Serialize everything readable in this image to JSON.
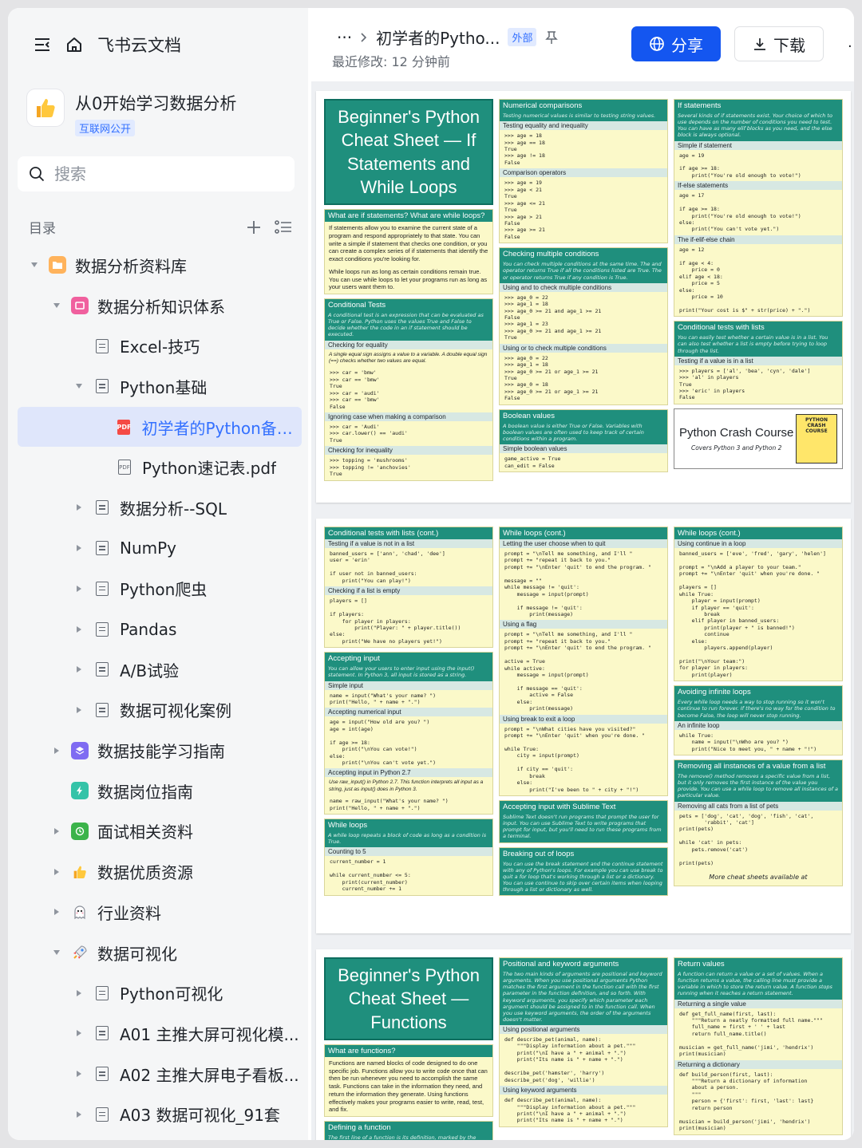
{
  "sidebar": {
    "brand": "飞书云文档",
    "space_title": "从0开始学习数据分析",
    "space_badge": "互联网公开",
    "search_placeholder": "搜索",
    "toc_label": "目录",
    "tree": [
      {
        "label": "数据分析资料库",
        "level": 0,
        "arrow": "down",
        "icon": "folder-orange"
      },
      {
        "label": "数据分析知识体系",
        "level": 1,
        "arrow": "down",
        "icon": "board-pink"
      },
      {
        "label": "Excel-技巧",
        "level": 2,
        "arrow": "",
        "icon": "doc"
      },
      {
        "label": "Python基础",
        "level": 2,
        "arrow": "down",
        "icon": "doc"
      },
      {
        "label": "初学者的Python备忘...",
        "level": 3,
        "arrow": "",
        "icon": "pdf-red",
        "active": true
      },
      {
        "label": "Python速记表.pdf",
        "level": 3,
        "arrow": "",
        "icon": "pdf"
      },
      {
        "label": "数据分析--SQL",
        "level": 2,
        "arrow": "right",
        "icon": "doc"
      },
      {
        "label": "NumPy",
        "level": 2,
        "arrow": "right",
        "icon": "doc"
      },
      {
        "label": "Python爬虫",
        "level": 2,
        "arrow": "right",
        "icon": "doc"
      },
      {
        "label": "Pandas",
        "level": 2,
        "arrow": "right",
        "icon": "doc"
      },
      {
        "label": "A/B试验",
        "level": 2,
        "arrow": "right",
        "icon": "doc"
      },
      {
        "label": "数据可视化案例",
        "level": 2,
        "arrow": "right",
        "icon": "doc"
      },
      {
        "label": "数据技能学习指南",
        "level": 1,
        "arrow": "right",
        "icon": "stack-purple"
      },
      {
        "label": "数据岗位指南",
        "level": 1,
        "arrow": "",
        "icon": "bolt-green"
      },
      {
        "label": "面试相关资料",
        "level": 1,
        "arrow": "right",
        "icon": "clock-green"
      },
      {
        "label": "数据优质资源",
        "level": 1,
        "arrow": "right",
        "icon": "thumb"
      },
      {
        "label": "行业资料",
        "level": 1,
        "arrow": "right",
        "icon": "ghost"
      },
      {
        "label": "数据可视化",
        "level": 1,
        "arrow": "down",
        "icon": "rocket"
      },
      {
        "label": "Python可视化",
        "level": 2,
        "arrow": "right",
        "icon": "doc"
      },
      {
        "label": "A01 主推大屏可视化模...",
        "level": 2,
        "arrow": "right",
        "icon": "doc"
      },
      {
        "label": "A02 主推大屏电子看板...",
        "level": 2,
        "arrow": "right",
        "icon": "doc"
      },
      {
        "label": "A03 数据可视化_91套",
        "level": 2,
        "arrow": "right",
        "icon": "doc"
      }
    ]
  },
  "header": {
    "ellipsis": "···",
    "doc_title": "初学者的Pytho...",
    "badge": "外部",
    "modified": "最近修改: 12 分钟前",
    "share": "分享",
    "download": "下载"
  },
  "sheet1": {
    "title": "Beginner's Python Cheat Sheet — If Statements and While Loops",
    "what_h": "What are if statements? What are while loops?",
    "what_p1": "If statements allow you to examine the current state of a program and respond appropriately to that state. You can write a simple if statement that checks one condition, or you can create a complex series of if statements that identify the exact conditions you're looking for.",
    "what_p2": "While loops run as long as certain conditions remain true. You can use while loops to let your programs run as long as your users want them to.",
    "cond_h": "Conditional Tests",
    "cond_d": "A conditional test is an expression that can be evaluated as True or False. Python uses the values True and False to decide whether the code in an if statement should be executed.",
    "eq_s": "Checking for equality",
    "eq_d": "A single equal sign assigns a value to a variable. A double equal sign (==) checks whether two values are equal.",
    "eq_c": ">>> car = 'bmw'\n>>> car == 'bmw'\nTrue\n>>> car = 'audi'\n>>> car == 'bmw'\nFalse",
    "ign_s": "Ignoring case when making a comparison",
    "ign_c": ">>> car = 'Audi'\n>>> car.lower() == 'audi'\nTrue",
    "neq_s": "Checking for inequality",
    "neq_c": ">>> topping = 'mushrooms'\n>>> topping != 'anchovies'\nTrue",
    "num_h": "Numerical comparisons",
    "num_d": "Testing numerical values is similar to testing string values.",
    "num_s1": "Testing equality and inequality",
    "num_c1": ">>> age = 18\n>>> age == 18\nTrue\n>>> age != 18\nFalse",
    "num_s2": "Comparison operators",
    "num_c2": ">>> age = 19\n>>> age < 21\nTrue\n>>> age <= 21\nTrue\n>>> age > 21\nFalse\n>>> age >= 21\nFalse",
    "mult_h": "Checking multiple conditions",
    "mult_d": "You can check multiple conditions at the same time. The and operator returns True if all the conditions listed are True. The or operator returns True if any condition is True.",
    "and_s": "Using and to check multiple conditions",
    "and_c": ">>> age_0 = 22\n>>> age_1 = 18\n>>> age_0 >= 21 and age_1 >= 21\nFalse\n>>> age_1 = 23\n>>> age_0 >= 21 and age_1 >= 21\nTrue",
    "or_s": "Using or to check multiple conditions",
    "or_c": ">>> age_0 = 22\n>>> age_1 = 18\n>>> age_0 >= 21 or age_1 >= 21\nTrue\n>>> age_0 = 18\n>>> age_0 >= 21 or age_1 >= 21\nFalse",
    "bool_h": "Boolean values",
    "bool_d": "A boolean value is either True or False. Variables with boolean values are often used to keep track of certain conditions within a program.",
    "bool_s": "Simple boolean values",
    "bool_c": "game_active = True\ncan_edit = False",
    "if_h": "If statements",
    "if_d": "Several kinds of if statements exist. Your choice of which to use depends on the number of conditions you need to test. You can have as many elif blocks as you need, and the else block is always optional.",
    "if_s1": "Simple if statement",
    "if_c1": "age = 19\n\nif age >= 18:\n    print(\"You're old enough to vote!\")",
    "if_s2": "If-else statements",
    "if_c2": "age = 17\n\nif age >= 18:\n    print(\"You're old enough to vote!\")\nelse:\n    print(\"You can't vote yet.\")",
    "if_s3": "The if-elif-else chain",
    "if_c3": "age = 12\n\nif age < 4:\n    price = 0\nelif age < 18:\n    price = 5\nelse:\n    price = 10\n\nprint(\"Your cost is $\" + str(price) + \".\")",
    "lst_h": "Conditional tests with lists",
    "lst_d": "You can easily test whether a certain value is in a list. You can also test whether a list is empty before trying to loop through the list.",
    "lst_s": "Testing if a value is in a list",
    "lst_c": ">>> players = ['al', 'bea', 'cyn', 'dale']\n>>> 'al' in players\nTrue\n>>> 'eric' in players\nFalse",
    "book_title": "Python Crash Course",
    "book_sub": "Covers Python 3 and Python 2",
    "book_cover": "PYTHON CRASH COURSE"
  },
  "sheet2": {
    "c1_h": "Conditional tests with lists (cont.)",
    "c1_s1": "Testing if a value is not in a list",
    "c1_c1": "banned_users = ['ann', 'chad', 'dee']\nuser = 'erin'\n\nif user not in banned_users:\n    print(\"You can play!\")",
    "c1_s2": "Checking if a list is empty",
    "c1_c2": "players = []\n\nif players:\n    for player in players:\n        print(\"Player: \" + player.title())\nelse:\n    print(\"We have no players yet!\")",
    "in_h": "Accepting input",
    "in_d": "You can allow your users to enter input using the input() statement. In Python 3, all input is stored as a string.",
    "in_s1": "Simple input",
    "in_c1": "name = input(\"What's your name? \")\nprint(\"Hello, \" + name + \".\")",
    "in_s2": "Accepting numerical input",
    "in_c2": "age = input(\"How old are you? \")\nage = int(age)\n\nif age >= 18:\n    print(\"\\nYou can vote!\")\nelse:\n    print(\"\\nYou can't vote yet.\")",
    "in_s3": "Accepting input in Python 2.7",
    "in_d3": "Use raw_input() in Python 2.7. This function interprets all input as a string, just as input() does in Python 3.",
    "in_c3": "name = raw_input(\"What's your name? \")\nprint(\"Hello, \" + name + \".\")",
    "wl_h": "While loops",
    "wl_d": "A while loop repeats a block of code as long as a condition is True.",
    "wl_s": "Counting to 5",
    "wl_c": "current_number = 1\n\nwhile current_number <= 5:\n    print(current_number)\n    current_number += 1",
    "w2_h": "While loops (cont.)",
    "w2_s1": "Letting the user choose when to quit",
    "w2_c1": "prompt = \"\\nTell me something, and I'll \"\nprompt += \"repeat it back to you.\"\nprompt += \"\\nEnter 'quit' to end the program. \"\n\nmessage = \"\"\nwhile message != 'quit':\n    message = input(prompt)\n\n    if message != 'quit':\n        print(message)",
    "w2_s2": "Using a flag",
    "w2_c2": "prompt = \"\\nTell me something, and I'll \"\nprompt += \"repeat it back to you.\"\nprompt += \"\\nEnter 'quit' to end the program. \"\n\nactive = True\nwhile active:\n    message = input(prompt)\n\n    if message == 'quit':\n        active = False\n    else:\n        print(message)",
    "w2_s3": "Using break to exit a loop",
    "w2_c3": "prompt = \"\\nWhat cities have you visited?\"\nprompt += \"\\nEnter 'quit' when you're done. \"\n\nwhile True:\n    city = input(prompt)\n\n    if city == 'quit':\n        break\n    else:\n        print(\"I've been to \" + city + \"!\")",
    "sub_h": "Accepting input with Sublime Text",
    "sub_d": "Sublime Text doesn't run programs that prompt the user for input. You can use Sublime Text to write programs that prompt for input, but you'll need to run these programs from a terminal.",
    "brk_h": "Breaking out of loops",
    "brk_d": "You can use the break statement and the continue statement with any of Python's loops. For example you can use break to quit a for loop that's working through a list or a dictionary. You can use continue to skip over certain items when looping through a list or dictionary as well.",
    "w3_h": "While loops (cont.)",
    "w3_s1": "Using continue in a loop",
    "w3_c1": "banned_users = ['eve', 'fred', 'gary', 'helen']\n\nprompt = \"\\nAdd a player to your team.\"\nprompt += \"\\nEnter 'quit' when you're done. \"\n\nplayers = []\nwhile True:\n    player = input(prompt)\n    if player == 'quit':\n        break\n    elif player in banned_users:\n        print(player + \" is banned!\")\n        continue\n    else:\n        players.append(player)\n\nprint(\"\\nYour team:\")\nfor player in players:\n    print(player)",
    "inf_h": "Avoiding infinite loops",
    "inf_d": "Every while loop needs a way to stop running so it won't continue to run forever. If there's no way for the condition to become False, the loop will never stop running.",
    "inf_s": "An infinite loop",
    "inf_c": "while True:\n    name = input(\"\\nWho are you? \")\n    print(\"Nice to meet you, \" + name + \"!\")",
    "rem_h": "Removing all instances of a value from a list",
    "rem_d": "The remove() method removes a specific value from a list, but it only removes the first instance of the value you provide. You can use a while loop to remove all instances of a particular value.",
    "rem_s": "Removing all cats from a list of pets",
    "rem_c": "pets = ['dog', 'cat', 'dog', 'fish', 'cat',\n        'rabbit', 'cat']\nprint(pets)\n\nwhile 'cat' in pets:\n    pets.remove('cat')\n\nprint(pets)",
    "more": "More cheat sheets available at"
  },
  "sheet3": {
    "title": "Beginner's Python Cheat Sheet — Functions",
    "what_h": "What are functions?",
    "what_p": "Functions are named blocks of code designed to do one specific job. Functions allow you to write code once that can then be run whenever you need to accomplish the same task. Functions can take in the information they need, and return the information they generate. Using functions effectively makes your programs easier to write, read, test, and fix.",
    "def_h": "Defining a function",
    "def_d": "The first line of a function is its definition, marked by the keyword def. The name of the function is followed by a set of parentheses and a colon. A docstring, in triple quotes,",
    "pos_h": "Positional and keyword arguments",
    "pos_d": "The two main kinds of arguments are positional and keyword arguments. When you use positional arguments Python matches the first argument in the function call with the first parameter in the function definition, and so forth. With keyword arguments, you specify which parameter each argument should be assigned to in the function call. When you use keyword arguments, the order of the arguments doesn't matter.",
    "pos_s1": "Using positional arguments",
    "pos_c1": "def describe_pet(animal, name):\n    \"\"\"Display information about a pet.\"\"\"\n    print(\"\\nI have a \" + animal + \".\")\n    print(\"Its name is \" + name + \".\")\n\ndescribe_pet('hamster', 'harry')\ndescribe_pet('dog', 'willie')",
    "pos_s2": "Using keyword arguments",
    "pos_c2": "def describe_pet(animal, name):\n    \"\"\"Display information about a pet.\"\"\"\n    print(\"\\nI have a \" + animal + \".\")\n    print(\"Its name is \" + name + \".\")",
    "ret_h": "Return values",
    "ret_d": "A function can return a value or a set of values. When a function returns a value, the calling line must provide a variable in which to store the return value. A function stops running when it reaches a return statement.",
    "ret_s1": "Returning a single value",
    "ret_c1": "def get_full_name(first, last):\n    \"\"\"Return a neatly formatted full name.\"\"\"\n    full_name = first + ' ' + last\n    return full_name.title()\n\nmusician = get_full_name('jimi', 'hendrix')\nprint(musician)",
    "ret_s2": "Returning a dictionary",
    "ret_c2": "def build_person(first, last):\n    \"\"\"Return a dictionary of information\n    about a person.\n    \"\"\"\n    person = {'first': first, 'last': last}\n    return person\n\nmusician = build_person('jimi', 'hendrix')\nprint(musician)"
  },
  "colors": {
    "accent": "#1456f0",
    "sheet_teal": "#1f8f7d",
    "sheet_yellow": "#fbf9c9",
    "active_bg": "#dfe6fb"
  }
}
